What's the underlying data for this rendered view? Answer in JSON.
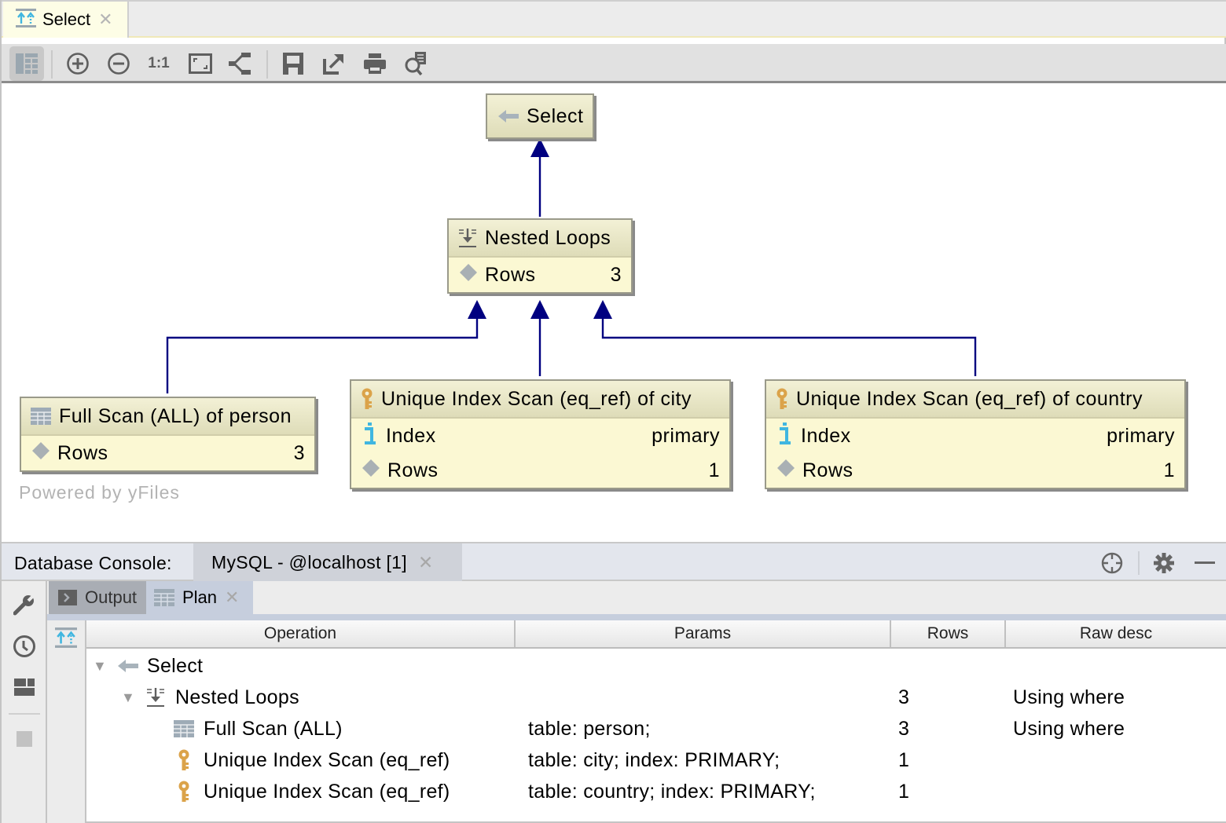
{
  "editor_tab": {
    "label": "Select",
    "icon": "explain-plan-icon"
  },
  "toolbar": {
    "buttons": [
      {
        "name": "toggle-table-view",
        "icon": "table-view-icon",
        "active": true
      },
      {
        "name": "zoom-in",
        "icon": "zoom-in-icon"
      },
      {
        "name": "zoom-out",
        "icon": "zoom-out-icon"
      },
      {
        "name": "actual-size",
        "icon": "actual-size-icon",
        "text": "1:1"
      },
      {
        "name": "fit-content",
        "icon": "fit-content-icon"
      },
      {
        "name": "layout",
        "icon": "layout-tree-icon"
      },
      {
        "name": "save",
        "icon": "save-icon"
      },
      {
        "name": "export",
        "icon": "export-icon"
      },
      {
        "name": "print",
        "icon": "print-icon"
      },
      {
        "name": "find",
        "icon": "find-icon"
      }
    ]
  },
  "graph": {
    "edge_color": "#000080",
    "nodes": {
      "select": {
        "title": "Select",
        "icon": "arrow-left-icon"
      },
      "nested": {
        "title": "Nested Loops",
        "icon": "nested-loops-icon",
        "rows_label": "Rows",
        "rows": "3"
      },
      "person": {
        "title": "Full Scan (ALL) of person",
        "icon": "table-icon",
        "rows_label": "Rows",
        "rows": "3"
      },
      "city": {
        "title": "Unique Index Scan (eq_ref) of city",
        "icon": "key-icon",
        "index_label": "Index",
        "index": "primary",
        "rows_label": "Rows",
        "rows": "1"
      },
      "country": {
        "title": "Unique Index Scan (eq_ref) of country",
        "icon": "key-icon",
        "index_label": "Index",
        "index": "primary",
        "rows_label": "Rows",
        "rows": "1"
      }
    },
    "watermark": "Powered by yFiles"
  },
  "console": {
    "title": "Database Console:",
    "tab": "MySQL - @localhost [1]",
    "subtabs": {
      "output": "Output",
      "plan": "Plan"
    }
  },
  "plan_table": {
    "columns": [
      "Operation",
      "Params",
      "Rows",
      "Raw desc"
    ],
    "rows": [
      {
        "op": "Select",
        "params": "",
        "rows": "",
        "raw": "",
        "icon": "arrow-left-icon",
        "expanded": true
      },
      {
        "op": "Nested Loops",
        "params": "",
        "rows": "3",
        "raw": "Using where",
        "icon": "nested-loops-icon",
        "expanded": true
      },
      {
        "op": "Full Scan (ALL)",
        "params": "table: person;",
        "rows": "3",
        "raw": "Using where",
        "icon": "table-icon"
      },
      {
        "op": "Unique Index Scan (eq_ref)",
        "params": "table: city; index: PRIMARY;",
        "rows": "1",
        "raw": "",
        "icon": "key-icon"
      },
      {
        "op": "Unique Index Scan (eq_ref)",
        "params": "table: country; index: PRIMARY;",
        "rows": "1",
        "raw": "",
        "icon": "key-icon"
      }
    ]
  }
}
